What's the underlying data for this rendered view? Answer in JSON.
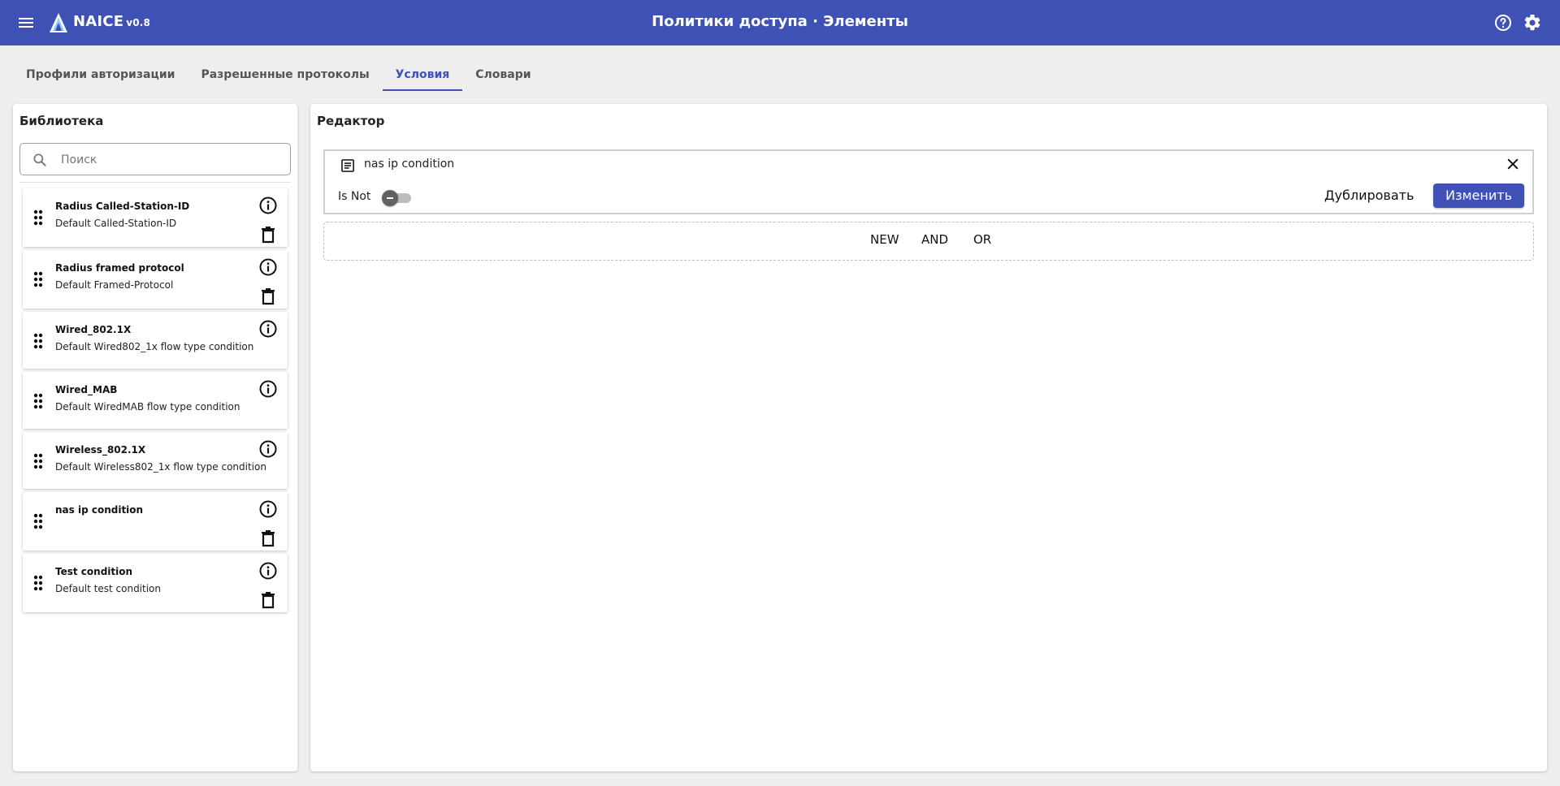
{
  "header": {
    "brand": "NAICE",
    "version": "v0.8",
    "title": "Политики доступа · Элементы",
    "menu_icon": "menu-icon",
    "logo": "naice-logo",
    "help_icon": "help-circle-icon",
    "settings_icon": "gear-icon",
    "bg_color": "#3f51b5"
  },
  "tabs": [
    {
      "label": "Профили авторизации",
      "active": false
    },
    {
      "label": "Разрешенные протоколы",
      "active": false
    },
    {
      "label": "Условия",
      "active": true
    },
    {
      "label": "Словари",
      "active": false
    }
  ],
  "library": {
    "title": "Библиотека",
    "search_placeholder": "Поиск",
    "search_value": "",
    "items": [
      {
        "title": "Radius Called-Station-ID",
        "desc": "Default Called-Station-ID",
        "deletable": true
      },
      {
        "title": "Radius framed protocol",
        "desc": "Default Framed-Protocol",
        "deletable": true
      },
      {
        "title": "Wired_802.1X",
        "desc": "Default Wired802_1x flow type condition",
        "deletable": false
      },
      {
        "title": "Wired_MAB",
        "desc": "Default WiredMAB flow type condition",
        "deletable": false
      },
      {
        "title": "Wireless_802.1X",
        "desc": "Default Wireless802_1x flow type condition",
        "deletable": false
      },
      {
        "title": "nas ip condition",
        "desc": "",
        "deletable": true
      },
      {
        "title": "Test condition",
        "desc": "Default test condition",
        "deletable": true
      }
    ]
  },
  "editor": {
    "title": "Редактор",
    "condition": {
      "name": "nas ip condition",
      "is_not_label": "Is Not",
      "is_not_enabled": false,
      "duplicate_label": "Дублировать",
      "edit_label": "Изменить"
    },
    "ops": {
      "new_label": "NEW",
      "and_label": "AND",
      "or_label": "OR"
    }
  }
}
